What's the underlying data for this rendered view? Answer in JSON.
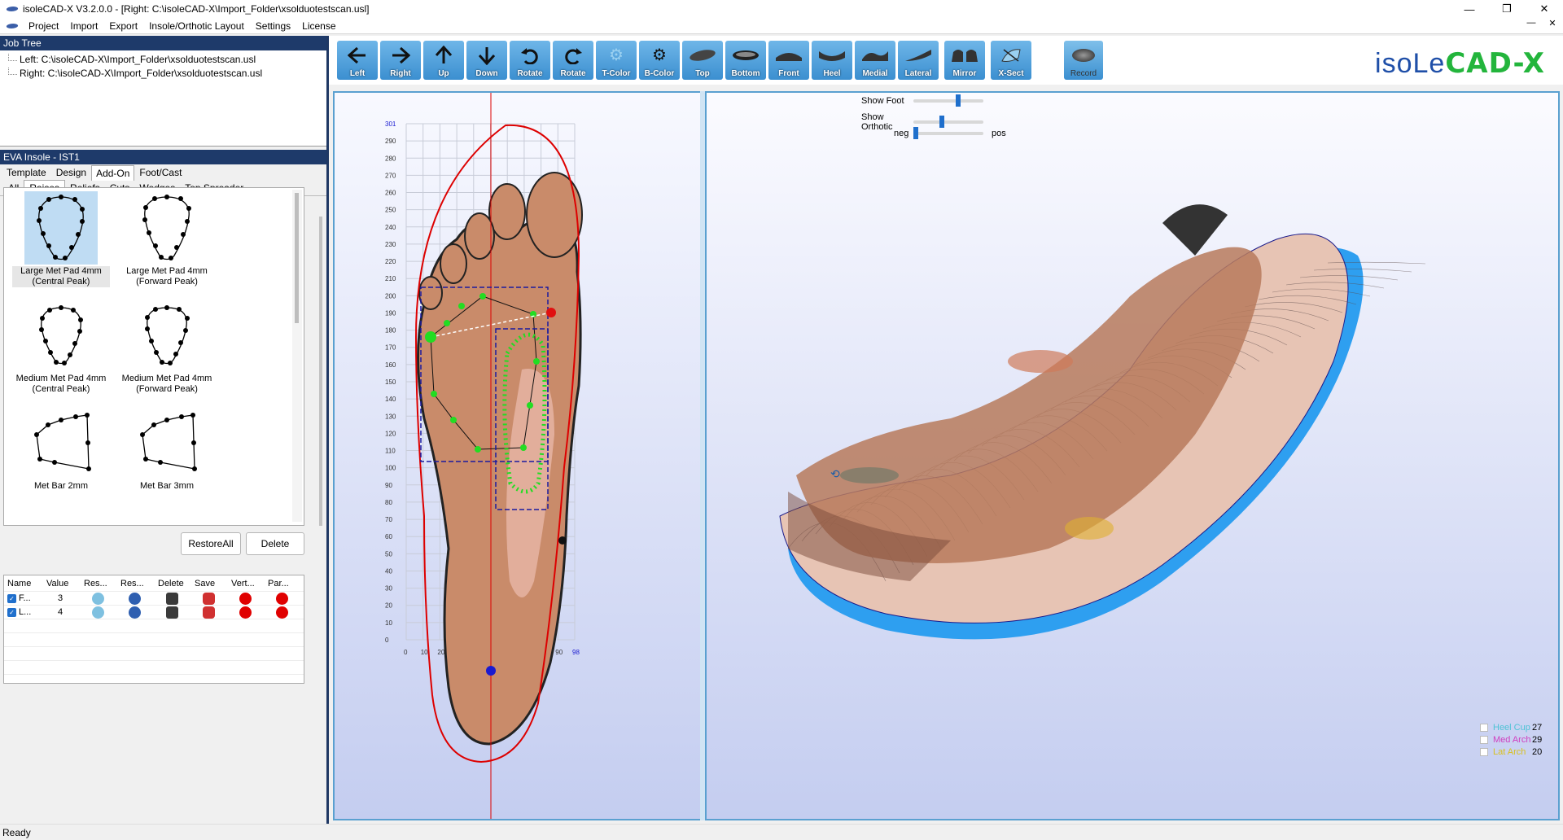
{
  "window": {
    "title": "isoleCAD-X V3.2.0.0 - [Right: C:\\isoleCAD-X\\Import_Folder\\xsolduotestscan.usl]",
    "minimize": "—",
    "maximize": "❐",
    "close": "✕"
  },
  "menu": [
    "Project",
    "Import",
    "Export",
    "Insole/Orthotic Layout",
    "Settings",
    "License"
  ],
  "menu_mini": {
    "minimize": "—",
    "close": "✕"
  },
  "job_tree": {
    "heading": "Job Tree",
    "items": [
      "Left: C:\\isoleCAD-X\\Import_Folder\\xsolduotestscan.usl",
      "Right: C:\\isoleCAD-X\\Import_Folder\\xsolduotestscan.usl"
    ]
  },
  "eva": {
    "heading": "EVA Insole - IST1",
    "tabs": [
      "Template",
      "Design",
      "Add-On",
      "Foot/Cast"
    ],
    "active_tab": "Add-On",
    "subtabs": [
      "All",
      "Raises",
      "Reliefs",
      "Cuts",
      "Wedges",
      "Top Spreader"
    ],
    "active_subtab": "Raises",
    "gallery": [
      {
        "line1": "Large Met Pad 4mm",
        "line2": "(Central Peak)"
      },
      {
        "line1": "Large Met Pad 4mm",
        "line2": "(Forward Peak)"
      },
      {
        "line1": "Medium Met Pad 4mm",
        "line2": "(Central Peak)"
      },
      {
        "line1": "Medium Met Pad 4mm",
        "line2": "(Forward Peak)"
      },
      {
        "line1": "Met Bar 2mm",
        "line2": ""
      },
      {
        "line1": "Met Bar 3mm",
        "line2": ""
      }
    ],
    "restore_all": "RestoreAll",
    "delete": "Delete",
    "table": {
      "headers": [
        "Name",
        "Value",
        "Res...",
        "Res...",
        "Delete",
        "Save",
        "Vert...",
        "Par..."
      ],
      "rows": [
        {
          "name": "F...",
          "value": "3"
        },
        {
          "name": "L...",
          "value": "4"
        }
      ]
    }
  },
  "toolbar": [
    {
      "label": "Left",
      "icon": "arrow-left-icon"
    },
    {
      "label": "Right",
      "icon": "arrow-right-icon"
    },
    {
      "label": "Up",
      "icon": "arrow-up-icon"
    },
    {
      "label": "Down",
      "icon": "arrow-down-icon"
    },
    {
      "label": "Rotate",
      "icon": "rotate-ccw-icon"
    },
    {
      "label": "Rotate",
      "icon": "rotate-cw-icon"
    },
    {
      "label": "T-Color",
      "icon": "gear-icon"
    },
    {
      "label": "B-Color",
      "icon": "gear-icon"
    },
    {
      "label": "Top",
      "icon": "insole-top-icon"
    },
    {
      "label": "Bottom",
      "icon": "insole-bottom-icon"
    },
    {
      "label": "Front",
      "icon": "insole-front-icon"
    },
    {
      "label": "Heel",
      "icon": "insole-heel-icon"
    },
    {
      "label": "Medial",
      "icon": "insole-medial-icon"
    },
    {
      "label": "Lateral",
      "icon": "insole-lateral-icon"
    },
    {
      "label": "Mirror",
      "icon": "mirror-icon"
    },
    {
      "label": "X-Sect",
      "icon": "cross-section-icon"
    }
  ],
  "record": "Record",
  "logo": {
    "part1": "isoLe",
    "part2": "CAD-X",
    "color1": "#1f4fa8",
    "color2": "#23b53c",
    "color3": "#e0312c"
  },
  "left_view": {
    "y_ticks": [
      "301",
      "290",
      "280",
      "270",
      "260",
      "250",
      "240",
      "230",
      "220",
      "210",
      "200",
      "190",
      "180",
      "170",
      "160",
      "150",
      "140",
      "130",
      "120",
      "110",
      "100",
      "90",
      "80",
      "70",
      "60",
      "50",
      "40",
      "30",
      "20",
      "10",
      "0"
    ],
    "x_ticks": [
      "0",
      "10",
      "20",
      "30",
      "40",
      "50",
      "60",
      "70",
      "80",
      "90",
      "98"
    ]
  },
  "sliders": [
    {
      "label": "Show Foot",
      "value": 0.62
    },
    {
      "label": "Show Orthotic",
      "value": 0.38
    },
    {
      "left_label": "neg",
      "right_label": "pos",
      "value": 0.0
    }
  ],
  "legend": [
    {
      "label": "Heel Cup",
      "value": "27",
      "color": "#4fc3d6"
    },
    {
      "label": "Med Arch",
      "value": "29",
      "color": "#d040c0"
    },
    {
      "label": "Lat Arch",
      "value": "20",
      "color": "#d8c020"
    }
  ],
  "status": "Ready"
}
